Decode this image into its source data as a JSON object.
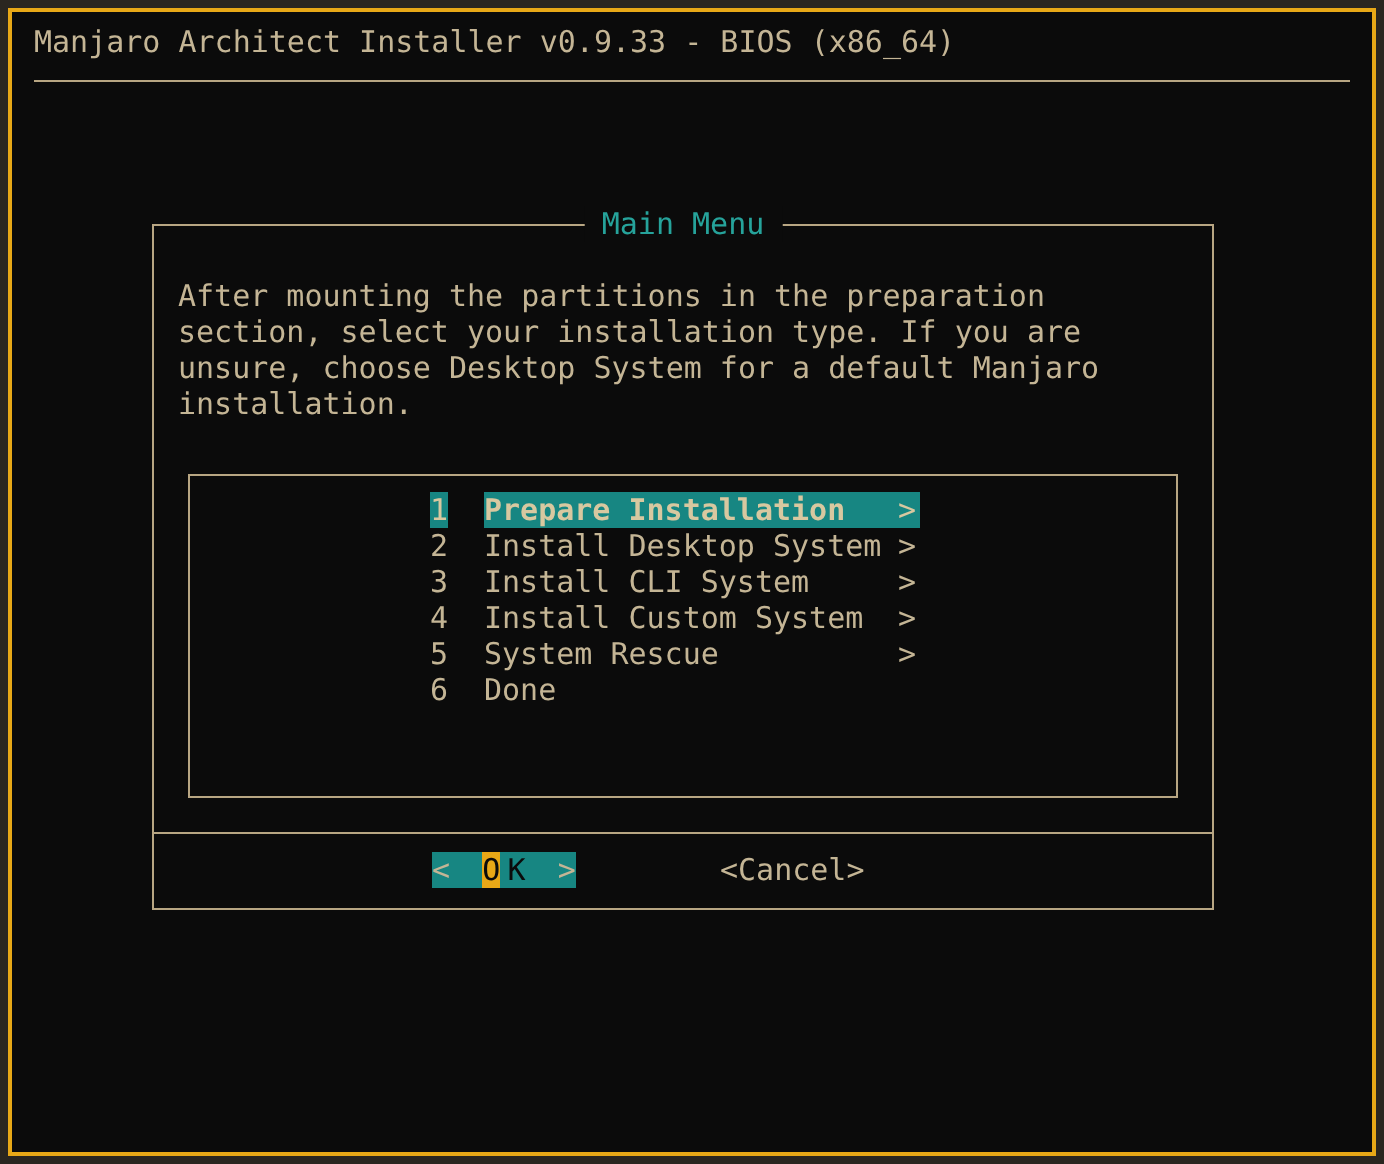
{
  "window": {
    "title": "Manjaro Architect Installer v0.9.33 - BIOS (x86_64)"
  },
  "dialog": {
    "title": "Main Menu",
    "message": "After mounting the partitions in the preparation section, select your installation type. If you are unsure, choose Desktop System for a default Manjaro installation.",
    "items": [
      {
        "number": "1",
        "label": "Prepare Installation",
        "arrow": ">",
        "selected": true
      },
      {
        "number": "2",
        "label": "Install Desktop System",
        "arrow": ">",
        "selected": false
      },
      {
        "number": "3",
        "label": "Install CLI System",
        "arrow": ">",
        "selected": false
      },
      {
        "number": "4",
        "label": "Install Custom System",
        "arrow": ">",
        "selected": false
      },
      {
        "number": "5",
        "label": "System Rescue",
        "arrow": ">",
        "selected": false
      },
      {
        "number": "6",
        "label": "Done",
        "selected": false
      }
    ],
    "buttons": [
      {
        "open": "<",
        "label": "OK",
        "close": ">",
        "selected": true
      },
      {
        "open": "<",
        "label": "Cancel",
        "close": ">",
        "selected": false
      }
    ]
  }
}
